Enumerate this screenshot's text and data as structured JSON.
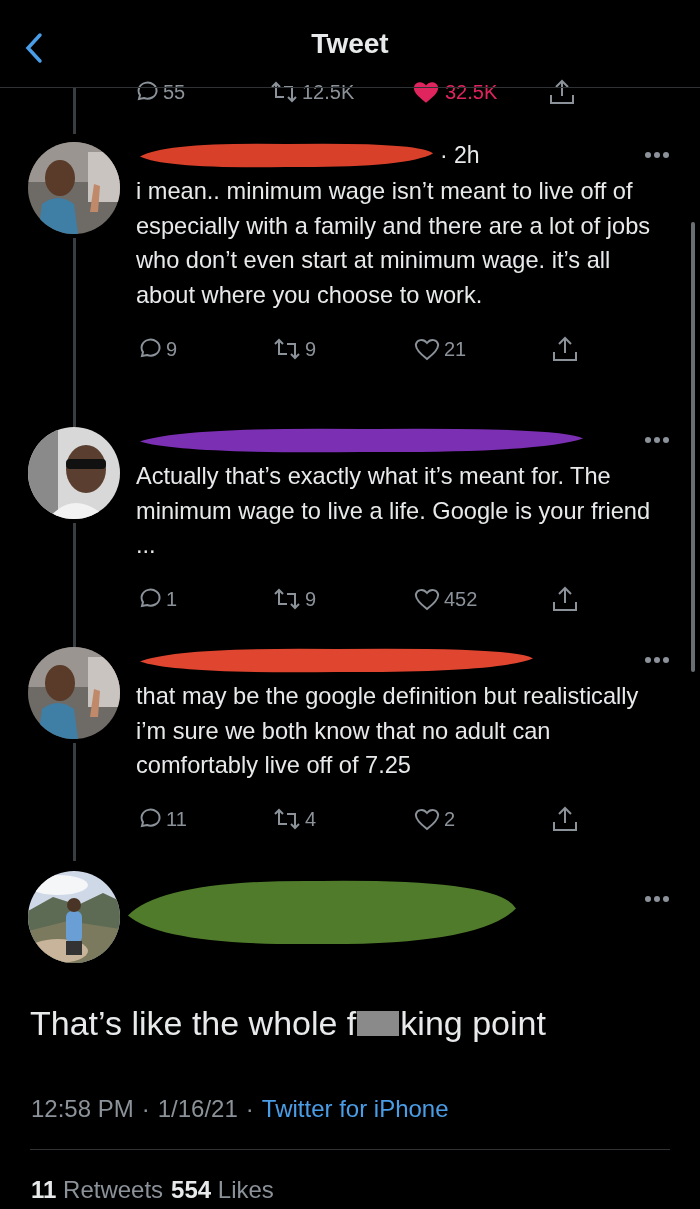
{
  "header": {
    "title": "Tweet"
  },
  "parent_actions": {
    "replies": "55",
    "retweets": "12.5K",
    "likes": "32.5K",
    "liked": true
  },
  "replies": [
    {
      "color": "#d9402a",
      "time": "· 2h",
      "text": "i mean.. minimum wage isn’t meant to live off of especially with a family and there are a lot of jobs who don’t even start at minimum wage. it’s all about where you choose to work.",
      "replies": "9",
      "retweets": "9",
      "likes": "21",
      "liked": false
    },
    {
      "color": "#7b2fb3",
      "text": "Actually that’s exactly what it’s meant for. The minimum wage to live a life. Google is your friend ...",
      "replies": "1",
      "retweets": "9",
      "likes": "452",
      "liked": false
    },
    {
      "color": "#e0452f",
      "text": "that may be the google definition but realistically i’m sure we both know that no adult can comfortably live off of 7.25",
      "replies": "11",
      "retweets": "4",
      "likes": "2",
      "liked": false
    }
  ],
  "main_tweet": {
    "color": "#4f7b2b",
    "text_before": "That’s like the whole f",
    "censored": true,
    "text_after": "king point",
    "meta": [
      {
        "kind": "plain",
        "text": "12:58 PM"
      },
      {
        "kind": "plain",
        "text": "·"
      },
      {
        "kind": "plain",
        "text": "1/16/21"
      },
      {
        "kind": "plain",
        "text": "·"
      },
      {
        "kind": "link",
        "text": "Twitter for iPhone"
      }
    ],
    "stats": [
      {
        "count": "11",
        "label": "Retweets"
      },
      {
        "count": "554",
        "label": "Likes"
      }
    ]
  }
}
